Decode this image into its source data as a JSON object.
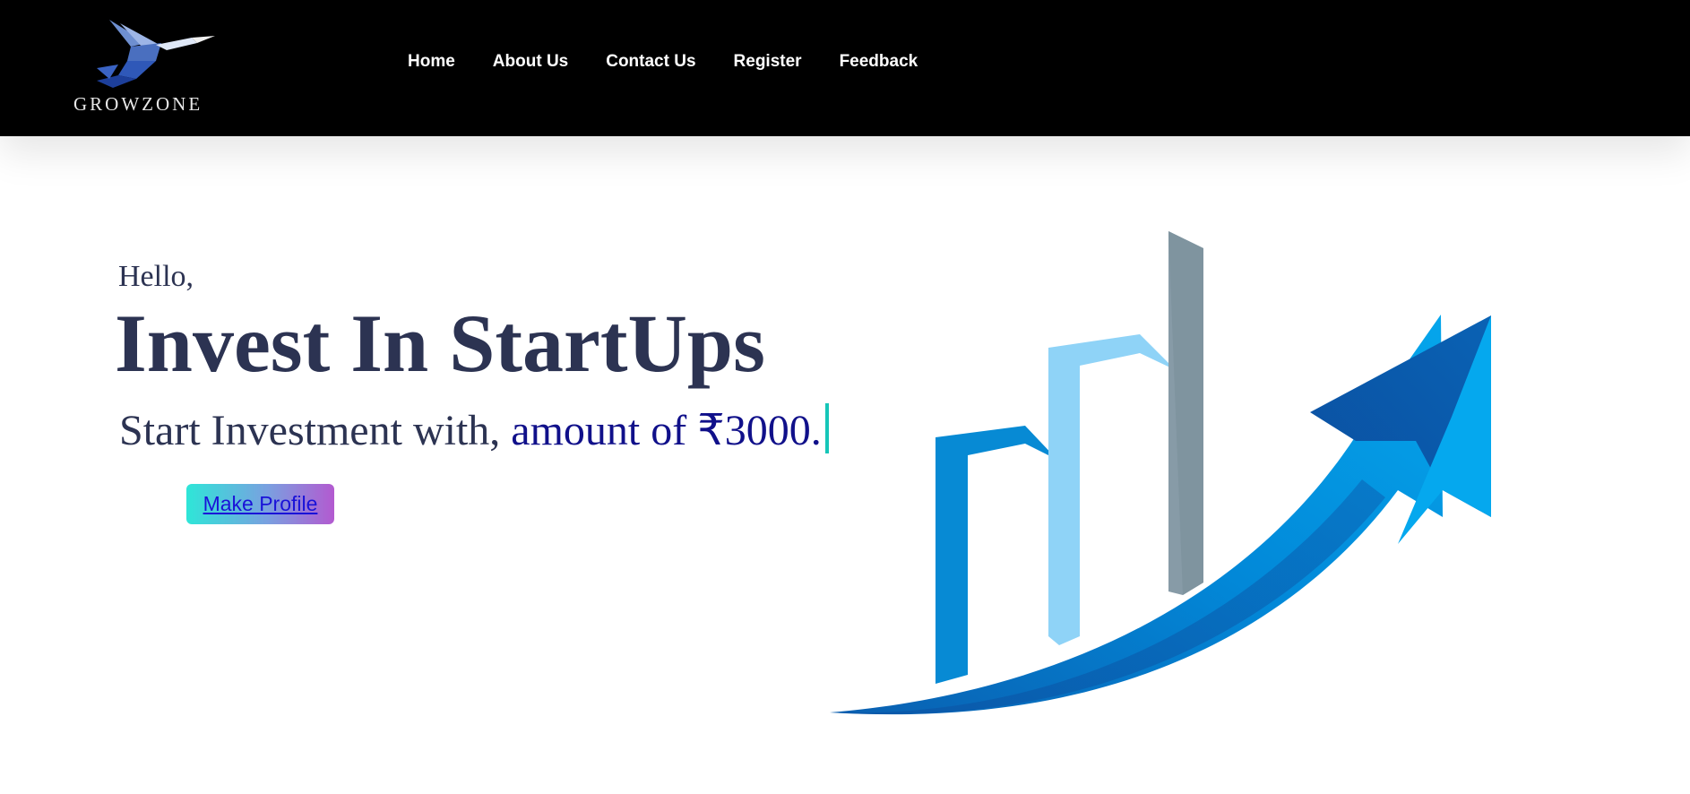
{
  "brand": {
    "name": "GROWZONE"
  },
  "nav": {
    "items": [
      {
        "label": "Home"
      },
      {
        "label": "About Us"
      },
      {
        "label": "Contact Us"
      },
      {
        "label": "Register"
      },
      {
        "label": "Feedback"
      }
    ]
  },
  "hero": {
    "greeting": "Hello,",
    "title": "Invest In StartUps",
    "subtitle_static": "Start Investment with, ",
    "subtitle_typed": "amount of ₹3000.",
    "cta_label": "Make Profile"
  },
  "colors": {
    "topbar": "#000000",
    "heading": "#2c3352",
    "typed_text": "#10108a",
    "caret": "#16c6b8",
    "button_gradient_start": "#2ee6d8",
    "button_gradient_end": "#b35ad0"
  },
  "icons": {
    "logo": "hummingbird-logo-icon",
    "graphic": "growth-arrow-bar-chart-icon"
  }
}
